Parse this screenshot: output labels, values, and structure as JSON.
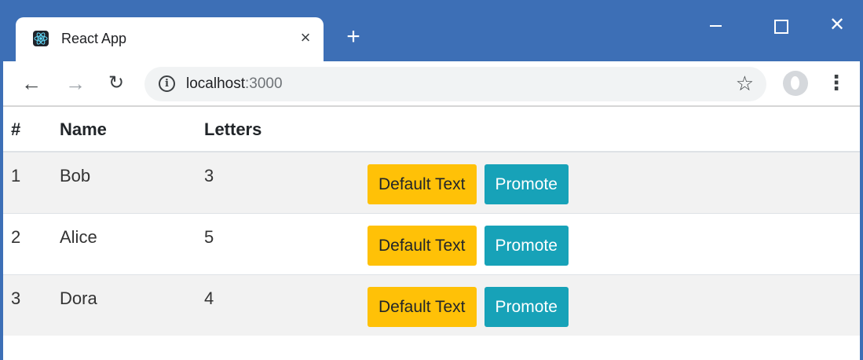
{
  "browser": {
    "tab_title": "React App",
    "tab_close_glyph": "×",
    "new_tab_glyph": "+",
    "url_host": "localhost",
    "url_port": ":3000",
    "window_close_glyph": "✕"
  },
  "colors": {
    "titlebar": "#3d6fb6",
    "warning": "#ffc107",
    "info": "#17a2b8",
    "stripe": "#f2f2f2"
  },
  "table": {
    "headers": [
      "#",
      "Name",
      "Letters"
    ],
    "rows": [
      {
        "index": "1",
        "name": "Bob",
        "letters": "3",
        "default_label": "Default Text",
        "promote_label": "Promote"
      },
      {
        "index": "2",
        "name": "Alice",
        "letters": "5",
        "default_label": "Default Text",
        "promote_label": "Promote"
      },
      {
        "index": "3",
        "name": "Dora",
        "letters": "4",
        "default_label": "Default Text",
        "promote_label": "Promote"
      }
    ]
  },
  "icons": {
    "favicon": "react-logo-icon",
    "back": "arrow-left-icon",
    "forward": "arrow-right-icon",
    "reload": "reload-icon",
    "info": "info-icon",
    "bookmark": "star-icon",
    "profile": "profile-avatar-icon",
    "menu": "kebab-menu-icon"
  }
}
